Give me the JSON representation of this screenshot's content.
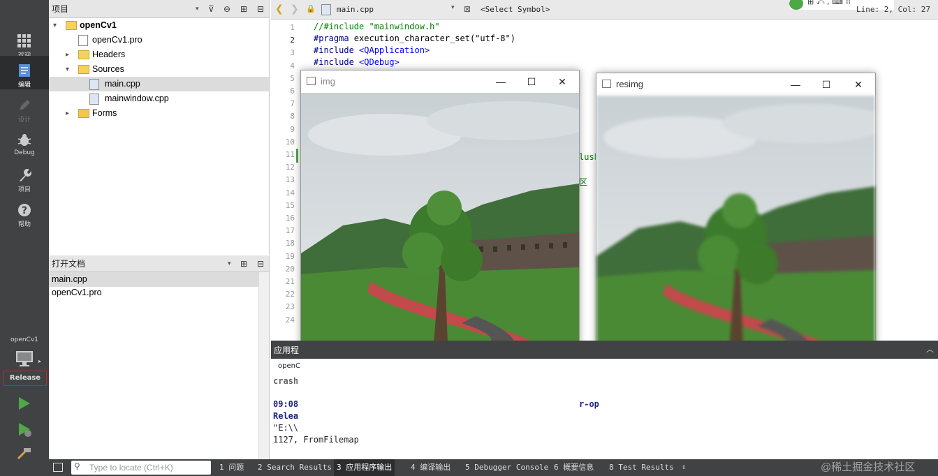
{
  "project_panel": {
    "title": "项目",
    "tree": [
      {
        "label": "openCv1",
        "type": "project",
        "expanded": true
      },
      {
        "label": "openCv1.pro",
        "type": "file"
      },
      {
        "label": "Headers",
        "type": "folder",
        "expanded": false
      },
      {
        "label": "Sources",
        "type": "folder",
        "expanded": true
      },
      {
        "label": "main.cpp",
        "type": "file",
        "selected": true
      },
      {
        "label": "mainwindow.cpp",
        "type": "file"
      },
      {
        "label": "Forms",
        "type": "folder",
        "expanded": false
      }
    ]
  },
  "open_docs": {
    "title": "打开文档",
    "items": [
      "main.cpp",
      "openCv1.pro"
    ]
  },
  "modes": [
    {
      "label": "欢迎",
      "icon": "grid-icon"
    },
    {
      "label": "编辑",
      "icon": "document-icon"
    },
    {
      "label": "设计",
      "icon": "pencil-icon"
    },
    {
      "label": "Debug",
      "icon": "bug-icon"
    },
    {
      "label": "项目",
      "icon": "wrench-icon"
    },
    {
      "label": "帮助",
      "icon": "help-icon"
    }
  ],
  "kit": {
    "project": "openCv1",
    "build": "Release"
  },
  "editor": {
    "filename": "main.cpp",
    "symbol": "<Select Symbol>",
    "position": "Line: 2, Col: 27",
    "lines": [
      "//#include \"mainwindow.h\"",
      "#pragma execution_character_set(\"utf-8\")",
      "#include <QApplication>",
      "#include <QDebug>"
    ],
    "line_numbers": [
      "1",
      "2",
      "3",
      "4",
      "5",
      "6",
      "7",
      "8",
      "9",
      "10",
      "11",
      "12",
      "13",
      "14",
      "15",
      "16",
      "17",
      "18",
      "19",
      "20",
      "21",
      "22",
      "23",
      "24"
    ],
    "frag_lush": "lush",
    "frag_xiang": "区"
  },
  "windows": [
    {
      "title": "img"
    },
    {
      "title": "resimg"
    }
  ],
  "output": {
    "title": "应用程",
    "tab": "openC",
    "lines": [
      "crash",
      "09:08",
      "Relea",
      "\"E:\\\\",
      "1127, FromFilemap"
    ],
    "frag_op": "r-op"
  },
  "statusbar": {
    "locate_placeholder": "Type to locate (Ctrl+K)",
    "tabs": [
      "1 问题",
      "2 Search Results",
      "3 应用程序输出",
      "4 编译输出",
      "5 Debugger Console",
      "6 概要信息",
      "8 Test Results"
    ],
    "watermark": "@稀土掘金技术社区"
  },
  "colors": {
    "sidebar": "#404244",
    "accent_green": "#4ea845",
    "comment_green": "#008000",
    "string_green": "#008000",
    "include_blue": "#0000ff"
  }
}
